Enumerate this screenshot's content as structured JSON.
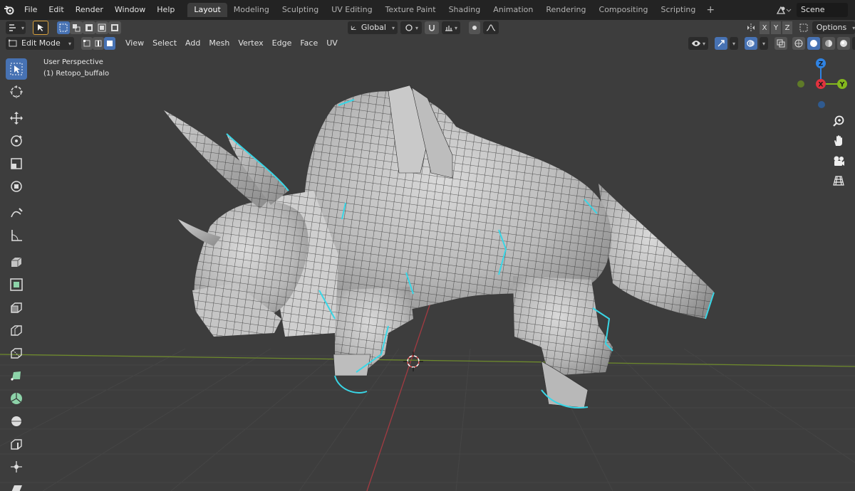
{
  "app": {
    "menu": [
      "File",
      "Edit",
      "Render",
      "Window",
      "Help"
    ],
    "workspaces": [
      {
        "label": "Layout",
        "active": true
      },
      {
        "label": "Modeling",
        "active": false
      },
      {
        "label": "Sculpting",
        "active": false
      },
      {
        "label": "UV Editing",
        "active": false
      },
      {
        "label": "Texture Paint",
        "active": false
      },
      {
        "label": "Shading",
        "active": false
      },
      {
        "label": "Animation",
        "active": false
      },
      {
        "label": "Rendering",
        "active": false
      },
      {
        "label": "Compositing",
        "active": false
      },
      {
        "label": "Scripting",
        "active": false
      }
    ],
    "add_workspace": "+",
    "scene": "Scene"
  },
  "header": {
    "orientation": "Global",
    "axes": [
      "X",
      "Y",
      "Z"
    ],
    "options": "Options",
    "mode": "Edit Mode",
    "menus": [
      "View",
      "Select",
      "Add",
      "Mesh",
      "Vertex",
      "Edge",
      "Face",
      "UV"
    ]
  },
  "viewport": {
    "perspective": "User Perspective",
    "object": "(1) Retopo_buffalo"
  },
  "colors": {
    "accent": "#4772b3",
    "seam": "#39d6e6",
    "x_axis": "#e1323e",
    "y_axis": "#84b81d",
    "z_axis": "#2f83e3"
  },
  "gizmo": {
    "x": "X",
    "y": "Y",
    "z": "Z"
  }
}
